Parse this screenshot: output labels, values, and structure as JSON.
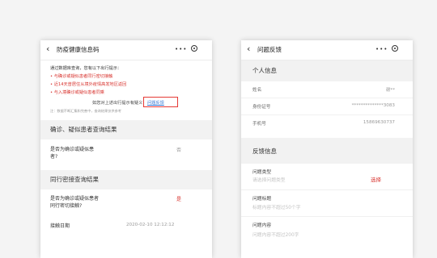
{
  "left_screen": {
    "nav": {
      "back_icon": "chevron-left-icon",
      "title": "防疫健康信息码",
      "more_icon": "more-dots-icon",
      "more": "•••",
      "target_icon": "target-icon"
    },
    "notice": {
      "intro": "通过数据库查询，您有以下出行提示：",
      "items": [
        "• 与确诊或疑似患者同行密切接触",
        "• 近14天曾居住从境外疫情高发地区返回",
        "• 与入境确诊或疑似患者同乘"
      ],
      "feedback_label": "如您对上述出行提示有疑义，",
      "feedback_link": "问题反馈",
      "note": "注：数据不断汇集和完善中，查询结果仅供参考"
    },
    "confirm_section": {
      "title": "确诊、疑似患者查询结果",
      "question": "是否为确诊或疑似患者?",
      "answer": "否"
    },
    "contact_section": {
      "title": "同行密接查询结果",
      "question": "是否为确诊或疑似患者同行密切接触?",
      "answer": "是",
      "date_label": "接触日期",
      "date_value": "2020-02-10 12:12:12"
    }
  },
  "right_screen": {
    "nav": {
      "back_icon": "chevron-left-icon",
      "title": "问题反馈",
      "more_icon": "more-dots-icon",
      "more": "•••",
      "target_icon": "target-icon"
    },
    "personal_section": {
      "title": "个人信息",
      "rows": [
        {
          "label": "姓名",
          "value": "谢**"
        },
        {
          "label": "身份证号",
          "value": "**************3083"
        },
        {
          "label": "手机号",
          "value": "15869630737"
        }
      ]
    },
    "feedback_section": {
      "title": "反馈信息",
      "type_label": "问题类型",
      "type_placeholder": "请选择问题类型",
      "type_action": "选择",
      "subject_label": "问题标题",
      "subject_placeholder": "标题内容不超过50个字",
      "content_label": "问题内容",
      "content_placeholder": "问题内容不超过200字"
    }
  },
  "colors": {
    "alert_red": "#d8342f",
    "link_blue": "#3477d4",
    "highlight_border": "#e53935"
  }
}
